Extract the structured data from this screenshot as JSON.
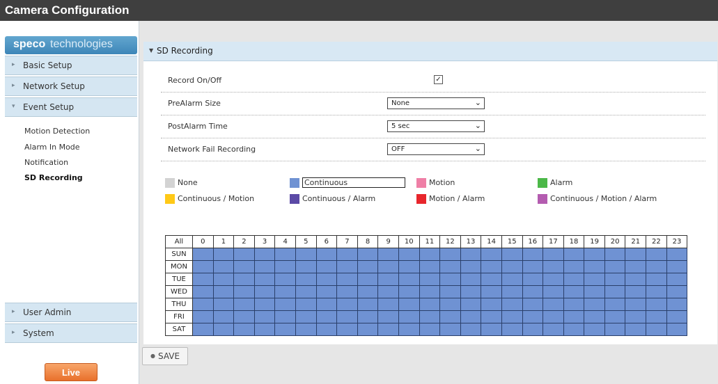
{
  "app": {
    "title": "Camera Configuration"
  },
  "logo": {
    "brand": "speco",
    "suffix": "technologies"
  },
  "sidebar": {
    "items": [
      {
        "label": "Basic Setup",
        "icon": "chevron-right-icon"
      },
      {
        "label": "Network Setup",
        "icon": "chevron-right-icon"
      },
      {
        "label": "Event Setup",
        "icon": "chevron-down-icon"
      },
      {
        "label": "User Admin",
        "icon": "chevron-right-icon"
      },
      {
        "label": "System",
        "icon": "chevron-right-icon"
      }
    ],
    "sub_items": [
      {
        "label": "Motion Detection"
      },
      {
        "label": "Alarm In Mode"
      },
      {
        "label": "Notification"
      },
      {
        "label": "SD Recording",
        "active": true
      }
    ],
    "live_label": "Live"
  },
  "panel": {
    "title": "SD Recording",
    "rows": [
      {
        "label": "Record On/Off",
        "type": "checkbox",
        "checked": true,
        "mark": "✓"
      },
      {
        "label": "PreAlarm Size",
        "type": "select",
        "value": "None"
      },
      {
        "label": "PostAlarm Time",
        "type": "select",
        "value": "5 sec"
      },
      {
        "label": "Network Fail Recording",
        "type": "select",
        "value": "OFF"
      }
    ]
  },
  "legend": [
    {
      "label": "None",
      "color": "#d3d3d3"
    },
    {
      "label": "Continuous",
      "color": "#6f92d3",
      "selected": true
    },
    {
      "label": "Motion",
      "color": "#ef7fa6"
    },
    {
      "label": "Alarm",
      "color": "#4cb848"
    },
    {
      "label": "Continuous / Motion",
      "color": "#ffc917"
    },
    {
      "label": "Continuous / Alarm",
      "color": "#5b4aa6"
    },
    {
      "label": "Motion / Alarm",
      "color": "#e8262c"
    },
    {
      "label": "Continuous / Motion / Alarm",
      "color": "#b45cb0"
    }
  ],
  "schedule": {
    "all_label": "All",
    "hours": [
      "0",
      "1",
      "2",
      "3",
      "4",
      "5",
      "6",
      "7",
      "8",
      "9",
      "10",
      "11",
      "12",
      "13",
      "14",
      "15",
      "16",
      "17",
      "18",
      "19",
      "20",
      "21",
      "22",
      "23"
    ],
    "days": [
      "SUN",
      "MON",
      "TUE",
      "WED",
      "THU",
      "FRI",
      "SAT"
    ],
    "cell_mode": "Continuous",
    "cell_color": "#6f92d3"
  },
  "save": {
    "label": "SAVE"
  }
}
